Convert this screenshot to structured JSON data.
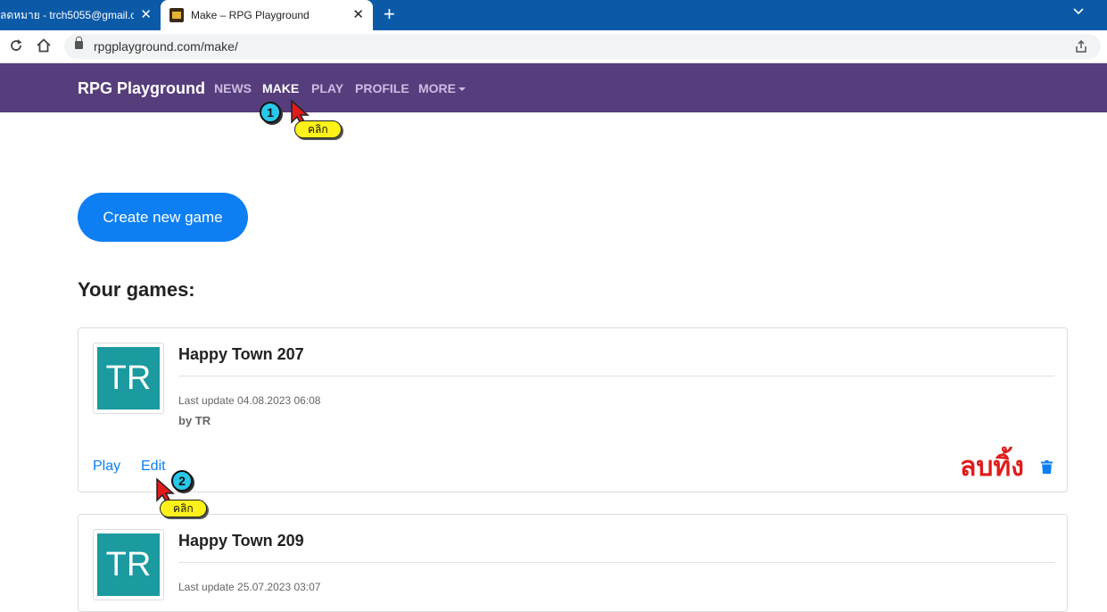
{
  "browser": {
    "tabs": [
      {
        "title": "ลดหมาย - trch5055@gmail.co",
        "active": false
      },
      {
        "title": "Make – RPG Playground",
        "active": true
      }
    ],
    "new_tab": "+",
    "close": "✕",
    "url": "rpgplayground.com/make/"
  },
  "navbar": {
    "brand": "RPG Playground",
    "links": [
      "NEWS",
      "MAKE",
      "PLAY",
      "PROFILE",
      "MORE"
    ],
    "active": "MAKE"
  },
  "content": {
    "create_button": "Create new game",
    "section_title": "Your games:",
    "games": [
      {
        "thumb": "TR",
        "title": "Happy Town 207",
        "last_update": "Last update 04.08.2023 06:08",
        "by": "by TR",
        "actions": [
          "Play",
          "Edit"
        ]
      },
      {
        "thumb": "TR",
        "title": "Happy Town 209",
        "last_update": "Last update 25.07.2023 03:07"
      }
    ]
  },
  "annotations": {
    "step1": "1",
    "step2": "2",
    "click_label": "คลิก",
    "delete_note": "ลบทิ้ง"
  },
  "colors": {
    "tabbar": "#0b5aa8",
    "navbar": "#563d7c",
    "primary": "#0d7ff2",
    "thumb": "#1b9aa0",
    "delete_note": "#e01b1b",
    "badge": "#29c7e8",
    "label": "#fff21a"
  },
  "icons": [
    "close-icon",
    "plus-icon",
    "chevron-down-icon",
    "reload-icon",
    "home-icon",
    "lock-icon",
    "share-icon",
    "trash-icon",
    "cursor-arrow-icon"
  ]
}
